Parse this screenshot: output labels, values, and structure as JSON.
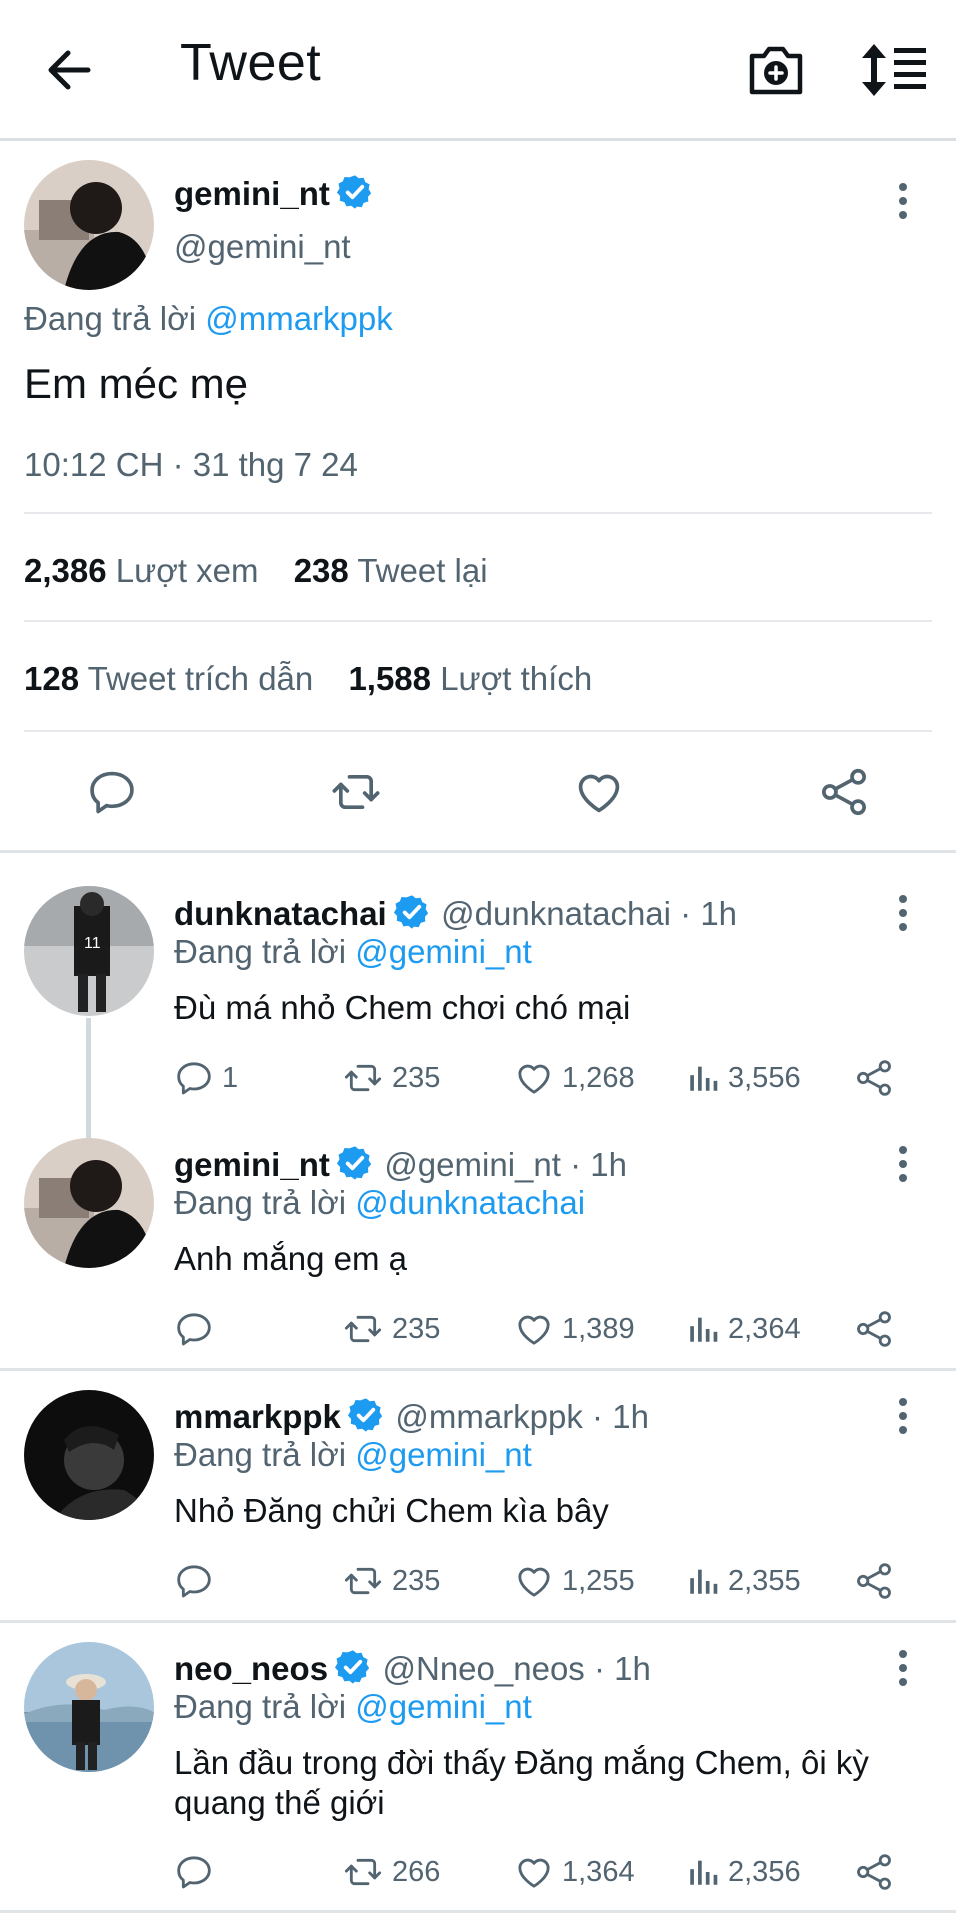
{
  "header": {
    "title": "Tweet"
  },
  "main_tweet": {
    "display_name": "gemini_nt",
    "handle": "@gemini_nt",
    "reply_prefix": "Đang trả lời",
    "reply_to": "@mmarkppk",
    "text": "Em méc mẹ",
    "timestamp": "10:12 CH · 31 thg 7 24",
    "views_count": "2,386",
    "views_label": "Lượt xem",
    "retweets_count": "238",
    "retweets_label": "Tweet lại",
    "quotes_count": "128",
    "quotes_label": "Tweet trích dẫn",
    "likes_count": "1,588",
    "likes_label": "Lượt thích"
  },
  "replies": [
    {
      "display_name": "dunknatachai",
      "meta": "@dunknatachai · 1h",
      "reply_prefix": "Đang trả lời",
      "reply_to": "@gemini_nt",
      "text": "Đù má nhỏ Chem chơi chó mại",
      "replies": "1",
      "retweets": "235",
      "likes": "1,268",
      "views": "3,556"
    },
    {
      "display_name": "gemini_nt",
      "meta": "@gemini_nt · 1h",
      "reply_prefix": "Đang trả lời",
      "reply_to": "@dunknatachai",
      "text": "Anh mắng em ạ",
      "replies": "",
      "retweets": "235",
      "likes": "1,389",
      "views": "2,364"
    },
    {
      "display_name": "mmarkppk",
      "meta": "@mmarkppk · 1h",
      "reply_prefix": "Đang trả lời",
      "reply_to": "@gemini_nt",
      "text": "Nhỏ Đăng chửi Chem kìa bây",
      "replies": "",
      "retweets": "235",
      "likes": "1,255",
      "views": "2,355"
    },
    {
      "display_name": "neo_neos",
      "meta": "@Nneo_neos · 1h",
      "reply_prefix": "Đang trả lời",
      "reply_to": "@gemini_nt",
      "text_line1": "Lần đầu trong đời thấy Đăng mắng Chem, ôi kỳ",
      "text_line2": "quang thế giới",
      "replies": "",
      "retweets": "266",
      "likes": "1,364",
      "views": "2,356"
    }
  ],
  "colors": {
    "accent": "#1d9bf0",
    "secondary_text": "#536471",
    "primary_text": "#0f1419"
  }
}
